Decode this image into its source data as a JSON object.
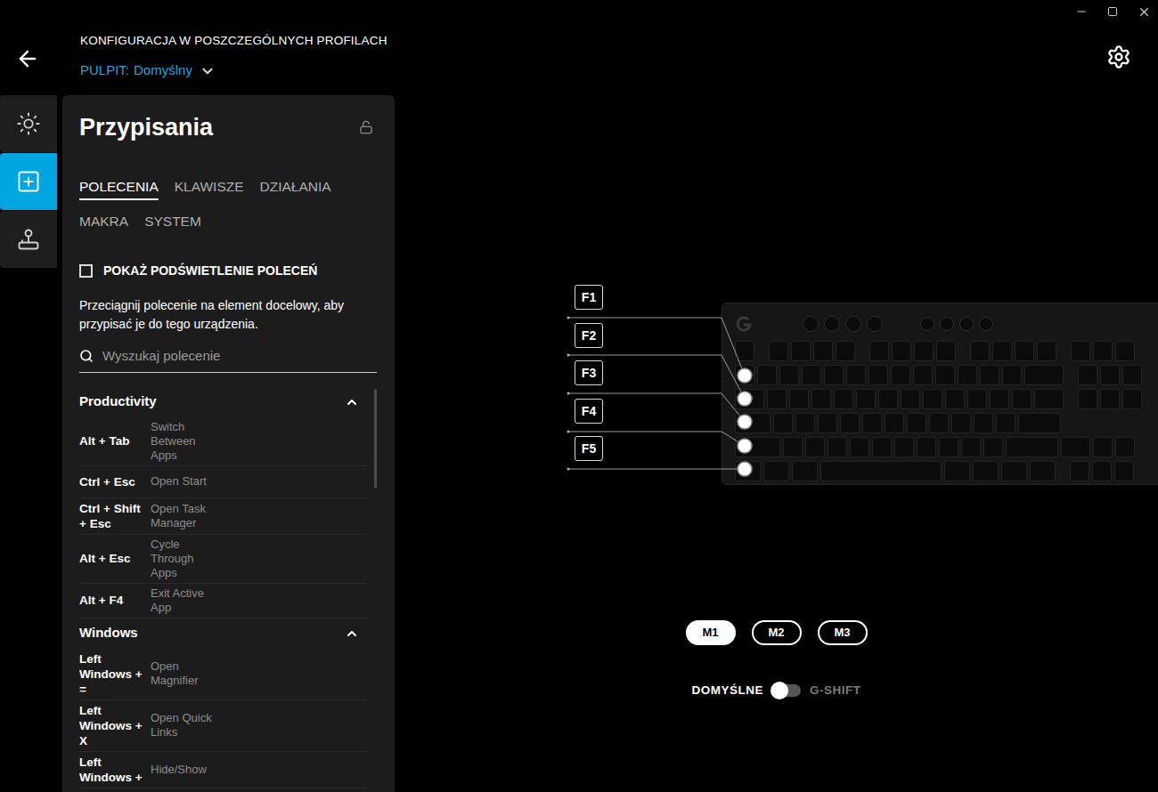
{
  "header": {
    "title": "KONFIGURACJA W POSZCZEGÓLNYCH PROFILACH",
    "profile_label": "PULPIT:",
    "profile_value": "Domyślny"
  },
  "rail": [
    {
      "kind": "lighting",
      "selected": false
    },
    {
      "kind": "assignments",
      "selected": true
    },
    {
      "kind": "game",
      "selected": false
    }
  ],
  "panel": {
    "title": "Przypisania",
    "locked": false
  },
  "tabs": [
    {
      "label": "POLECENIA",
      "selected": true
    },
    {
      "label": "KLAWISZE",
      "selected": false
    },
    {
      "label": "DZIAŁANIA",
      "selected": false
    },
    {
      "label": "MAKRA",
      "selected": false
    },
    {
      "label": "SYSTEM",
      "selected": false
    }
  ],
  "checkbox": {
    "label": "POKAŻ PODŚWIETLENIE POLECEŃ",
    "checked": false
  },
  "instruction": "Przeciągnij polecenie na element docelowy, aby przypisać je do tego urządzenia.",
  "search": {
    "placeholder": "Wyszukaj polecenie"
  },
  "sections": [
    {
      "title": "Productivity",
      "expanded": true,
      "items": [
        {
          "keys": "Alt + Tab",
          "description": "Switch Between Apps"
        },
        {
          "keys": "Ctrl + Esc",
          "description": "Open Start"
        },
        {
          "keys": "Ctrl + Shift + Esc",
          "description": "Open Task Manager"
        },
        {
          "keys": "Alt + Esc",
          "description": "Cycle Through Apps"
        },
        {
          "keys": "Alt + F4",
          "description": "Exit Active App"
        }
      ]
    },
    {
      "title": "Windows",
      "expanded": true,
      "items": [
        {
          "keys": "Left Windows + =",
          "description": "Open Magnifier"
        },
        {
          "keys": "Left Windows + X",
          "description": "Open Quick Links"
        },
        {
          "keys": "Left Windows +",
          "description": "Hide/Show"
        }
      ]
    }
  ],
  "device": {
    "g_keys": [
      {
        "label": "F1"
      },
      {
        "label": "F2"
      },
      {
        "label": "F3"
      },
      {
        "label": "F4"
      },
      {
        "label": "F5"
      }
    ]
  },
  "modes": [
    {
      "label": "M1",
      "selected": true
    },
    {
      "label": "M2",
      "selected": false
    },
    {
      "label": "M3",
      "selected": false
    }
  ],
  "gshift": {
    "left_label": "DOMYŚLNE",
    "right_label": "G-SHIFT",
    "on": false
  }
}
